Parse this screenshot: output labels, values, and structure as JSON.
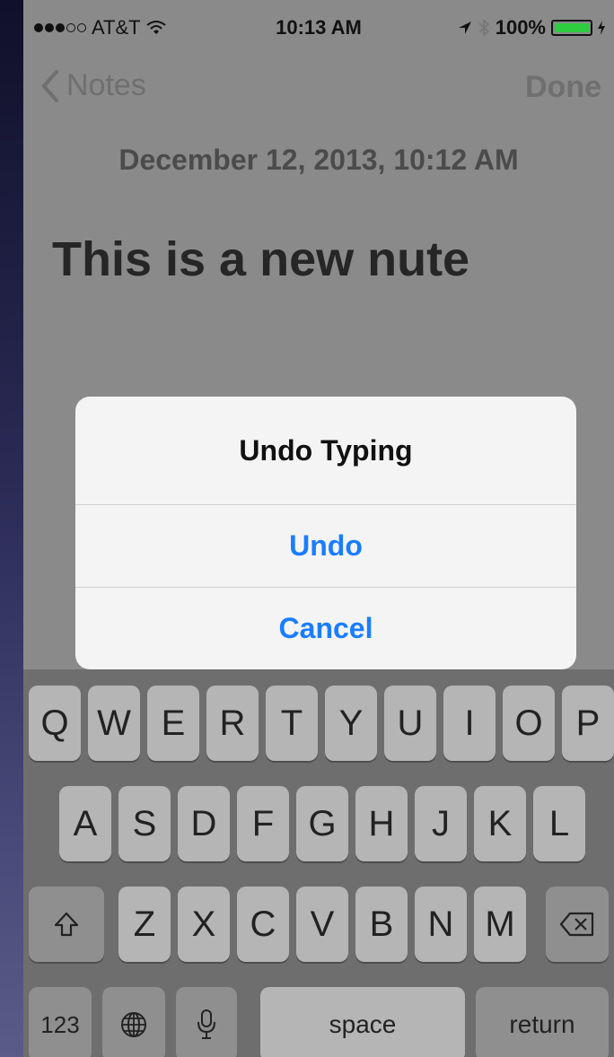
{
  "status_bar": {
    "carrier": "AT&T",
    "time": "10:13 AM",
    "battery": "100%"
  },
  "nav": {
    "back_label": "Notes",
    "done_label": "Done"
  },
  "note": {
    "date": "December 12, 2013, 10:12 AM",
    "text": "This is a new nute"
  },
  "alert": {
    "title": "Undo Typing",
    "undo_label": "Undo",
    "cancel_label": "Cancel"
  },
  "keyboard": {
    "row1": [
      "Q",
      "W",
      "E",
      "R",
      "T",
      "Y",
      "U",
      "I",
      "O",
      "P"
    ],
    "row2": [
      "A",
      "S",
      "D",
      "F",
      "G",
      "H",
      "J",
      "K",
      "L"
    ],
    "row3": [
      "Z",
      "X",
      "C",
      "V",
      "B",
      "N",
      "M"
    ],
    "num_label": "123",
    "space_label": "space",
    "return_label": "return"
  },
  "colors": {
    "accent": "#1a7dff",
    "battery": "#2ecc40"
  },
  "icons": {
    "back": "chevron-left-icon",
    "shift": "shift-icon",
    "delete": "delete-icon",
    "globe": "globe-icon",
    "mic": "microphone-icon"
  }
}
